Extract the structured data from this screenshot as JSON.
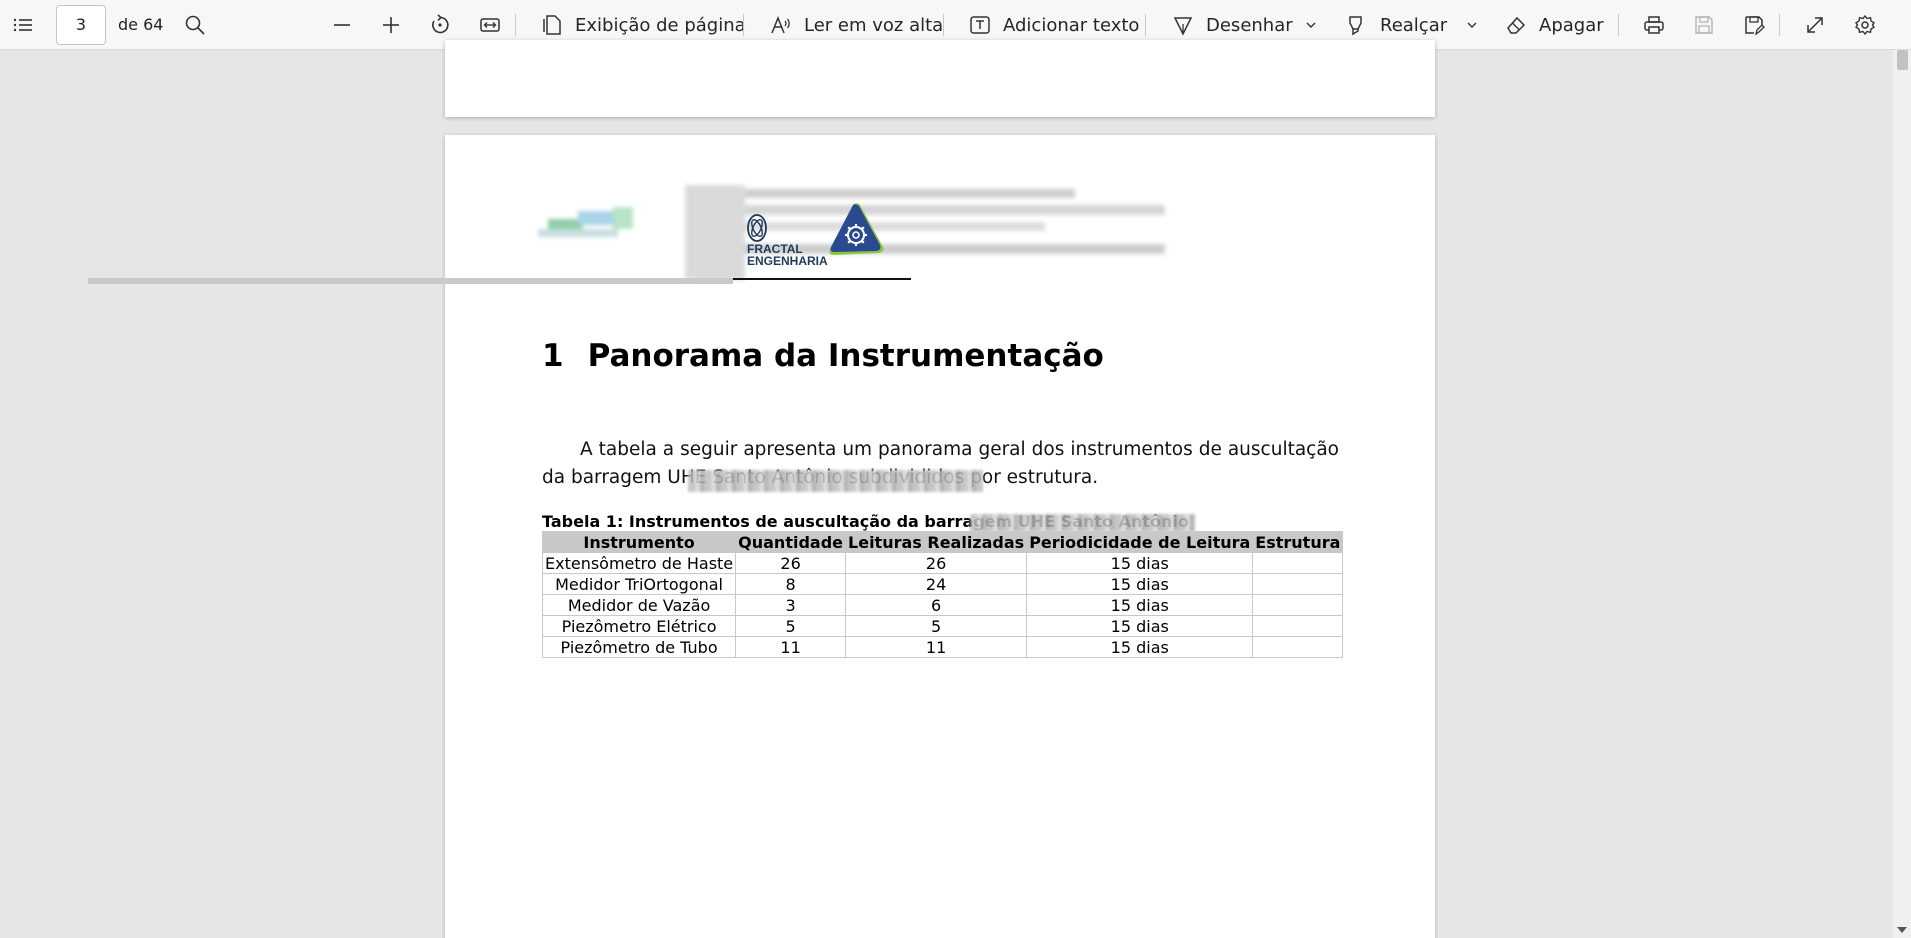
{
  "toolbar": {
    "current_page": "3",
    "page_count_label": "de 64",
    "page_view_label": "Exibição de página",
    "read_aloud_label": "Ler em voz alta",
    "add_text_label": "Adicionar texto",
    "draw_label": "Desenhar",
    "highlight_label": "Realçar",
    "erase_label": "Apagar"
  },
  "document": {
    "logo_text_line1": "FRACTAL",
    "logo_text_line2": "ENGENHARIA",
    "section_number": "1",
    "section_title": "Panorama da Instrumentação",
    "paragraph": "A tabela a seguir apresenta um panorama geral dos instrumentos de auscultação da barragem UHE Santo Antônio subdivididos por estrutura.",
    "table_caption": "Tabela 1: Instrumentos de auscultação da barragem UHE Santo Antônio",
    "table": {
      "headers": [
        "Instrumento",
        "Quantidade",
        "Leituras Realizadas",
        "Periodicidade de Leitura",
        "Estrutura"
      ],
      "rows": [
        [
          "Extensômetro de Haste",
          "26",
          "26",
          "15 dias",
          ""
        ],
        [
          "Medidor TriOrtogonal",
          "8",
          "24",
          "15 dias",
          ""
        ],
        [
          "Medidor de Vazão",
          "3",
          "6",
          "15 dias",
          ""
        ],
        [
          "Piezômetro Elétrico",
          "5",
          "5",
          "15 dias",
          ""
        ],
        [
          "Piezômetro de Tubo",
          "11",
          "11",
          "15 dias",
          ""
        ]
      ]
    }
  }
}
